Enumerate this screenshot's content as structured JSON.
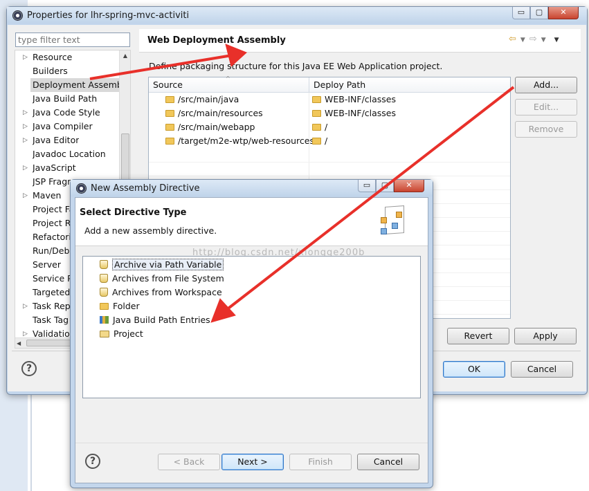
{
  "props_window": {
    "title": "Properties for lhr-spring-mvc-activiti",
    "filter_placeholder": "type filter text",
    "nav_items": [
      {
        "label": "Resource",
        "expandable": true
      },
      {
        "label": "Builders",
        "expandable": false
      },
      {
        "label": "Deployment Assembly",
        "expandable": false,
        "selected": true
      },
      {
        "label": "Java Build Path",
        "expandable": false
      },
      {
        "label": "Java Code Style",
        "expandable": true
      },
      {
        "label": "Java Compiler",
        "expandable": true
      },
      {
        "label": "Java Editor",
        "expandable": true
      },
      {
        "label": "Javadoc Location",
        "expandable": false
      },
      {
        "label": "JavaScript",
        "expandable": true
      },
      {
        "label": "JSP Fragm",
        "expandable": false
      },
      {
        "label": "Maven",
        "expandable": true
      },
      {
        "label": "Project Fa",
        "expandable": false
      },
      {
        "label": "Project Re",
        "expandable": false
      },
      {
        "label": "Refactorin",
        "expandable": false
      },
      {
        "label": "Run/Debu",
        "expandable": false
      },
      {
        "label": "Server",
        "expandable": false
      },
      {
        "label": "Service Po",
        "expandable": false
      },
      {
        "label": "Targeted",
        "expandable": false
      },
      {
        "label": "Task Repo",
        "expandable": true
      },
      {
        "label": "Task Tag",
        "expandable": false
      },
      {
        "label": "Validation",
        "expandable": true
      }
    ],
    "page_title": "Web Deployment Assembly",
    "description": "Define packaging structure for this Java EE Web Application project.",
    "table": {
      "columns": [
        "Source",
        "Deploy Path"
      ],
      "rows": [
        {
          "source": "/src/main/java",
          "deploy": "WEB-INF/classes"
        },
        {
          "source": "/src/main/resources",
          "deploy": "WEB-INF/classes"
        },
        {
          "source": "/src/main/webapp",
          "deploy": "/"
        },
        {
          "source": "/target/m2e-wtp/web-resources",
          "deploy": "/"
        }
      ]
    },
    "buttons": {
      "add": "Add...",
      "edit": "Edit...",
      "remove": "Remove",
      "revert": "Revert",
      "apply": "Apply",
      "ok": "OK",
      "cancel": "Cancel"
    }
  },
  "dialog": {
    "title": "New Assembly Directive",
    "heading": "Select Directive Type",
    "subheading": "Add a new assembly directive.",
    "watermark": "http://blog.csdn.net/xiongge200b",
    "items": [
      {
        "label": "Archive via Path Variable",
        "icon": "jar-icon",
        "selected": true
      },
      {
        "label": "Archives from File System",
        "icon": "jar-icon"
      },
      {
        "label": "Archives from Workspace",
        "icon": "jar-icon"
      },
      {
        "label": "Folder",
        "icon": "folder-icon"
      },
      {
        "label": "Java Build Path Entries",
        "icon": "library-icon"
      },
      {
        "label": "Project",
        "icon": "project-icon"
      }
    ],
    "buttons": {
      "back": "< Back",
      "next": "Next >",
      "finish": "Finish",
      "cancel": "Cancel"
    }
  },
  "annotation_color": "#e8302a"
}
